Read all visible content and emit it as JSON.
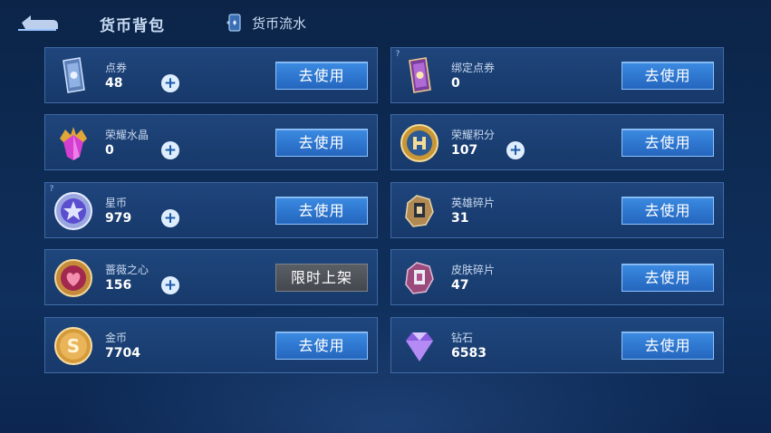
{
  "header": {
    "title": "货币背包",
    "flow_label": "货币流水"
  },
  "currencies": [
    {
      "name": "点券",
      "value": "48",
      "button": "去使用",
      "has_plus": true
    },
    {
      "name": "绑定点券",
      "value": "0",
      "button": "去使用",
      "has_plus": false
    },
    {
      "name": "荣耀水晶",
      "value": "0",
      "button": "去使用",
      "has_plus": true
    },
    {
      "name": "荣耀积分",
      "value": "107",
      "button": "去使用",
      "has_plus": true
    },
    {
      "name": "星币",
      "value": "979",
      "button": "去使用",
      "has_plus": true
    },
    {
      "name": "英雄碎片",
      "value": "31",
      "button": "去使用",
      "has_plus": false
    },
    {
      "name": "蔷薇之心",
      "value": "156",
      "button": "限时上架",
      "has_plus": true
    },
    {
      "name": "皮肤碎片",
      "value": "47",
      "button": "去使用",
      "has_plus": false
    },
    {
      "name": "金币",
      "value": "7704",
      "button": "去使用",
      "has_plus": false
    },
    {
      "name": "钻石",
      "value": "6583",
      "button": "去使用",
      "has_plus": false
    }
  ],
  "icons": [
    "coupon-icon",
    "bound-coupon-icon",
    "crystal-icon",
    "honor-points-icon",
    "star-coin-icon",
    "hero-fragment-icon",
    "rose-heart-icon",
    "skin-fragment-icon",
    "gold-coin-icon",
    "diamond-icon"
  ],
  "colors": {
    "background": "#0d2a52",
    "button": "#2e76cf",
    "button_disabled": "#4e5258"
  }
}
